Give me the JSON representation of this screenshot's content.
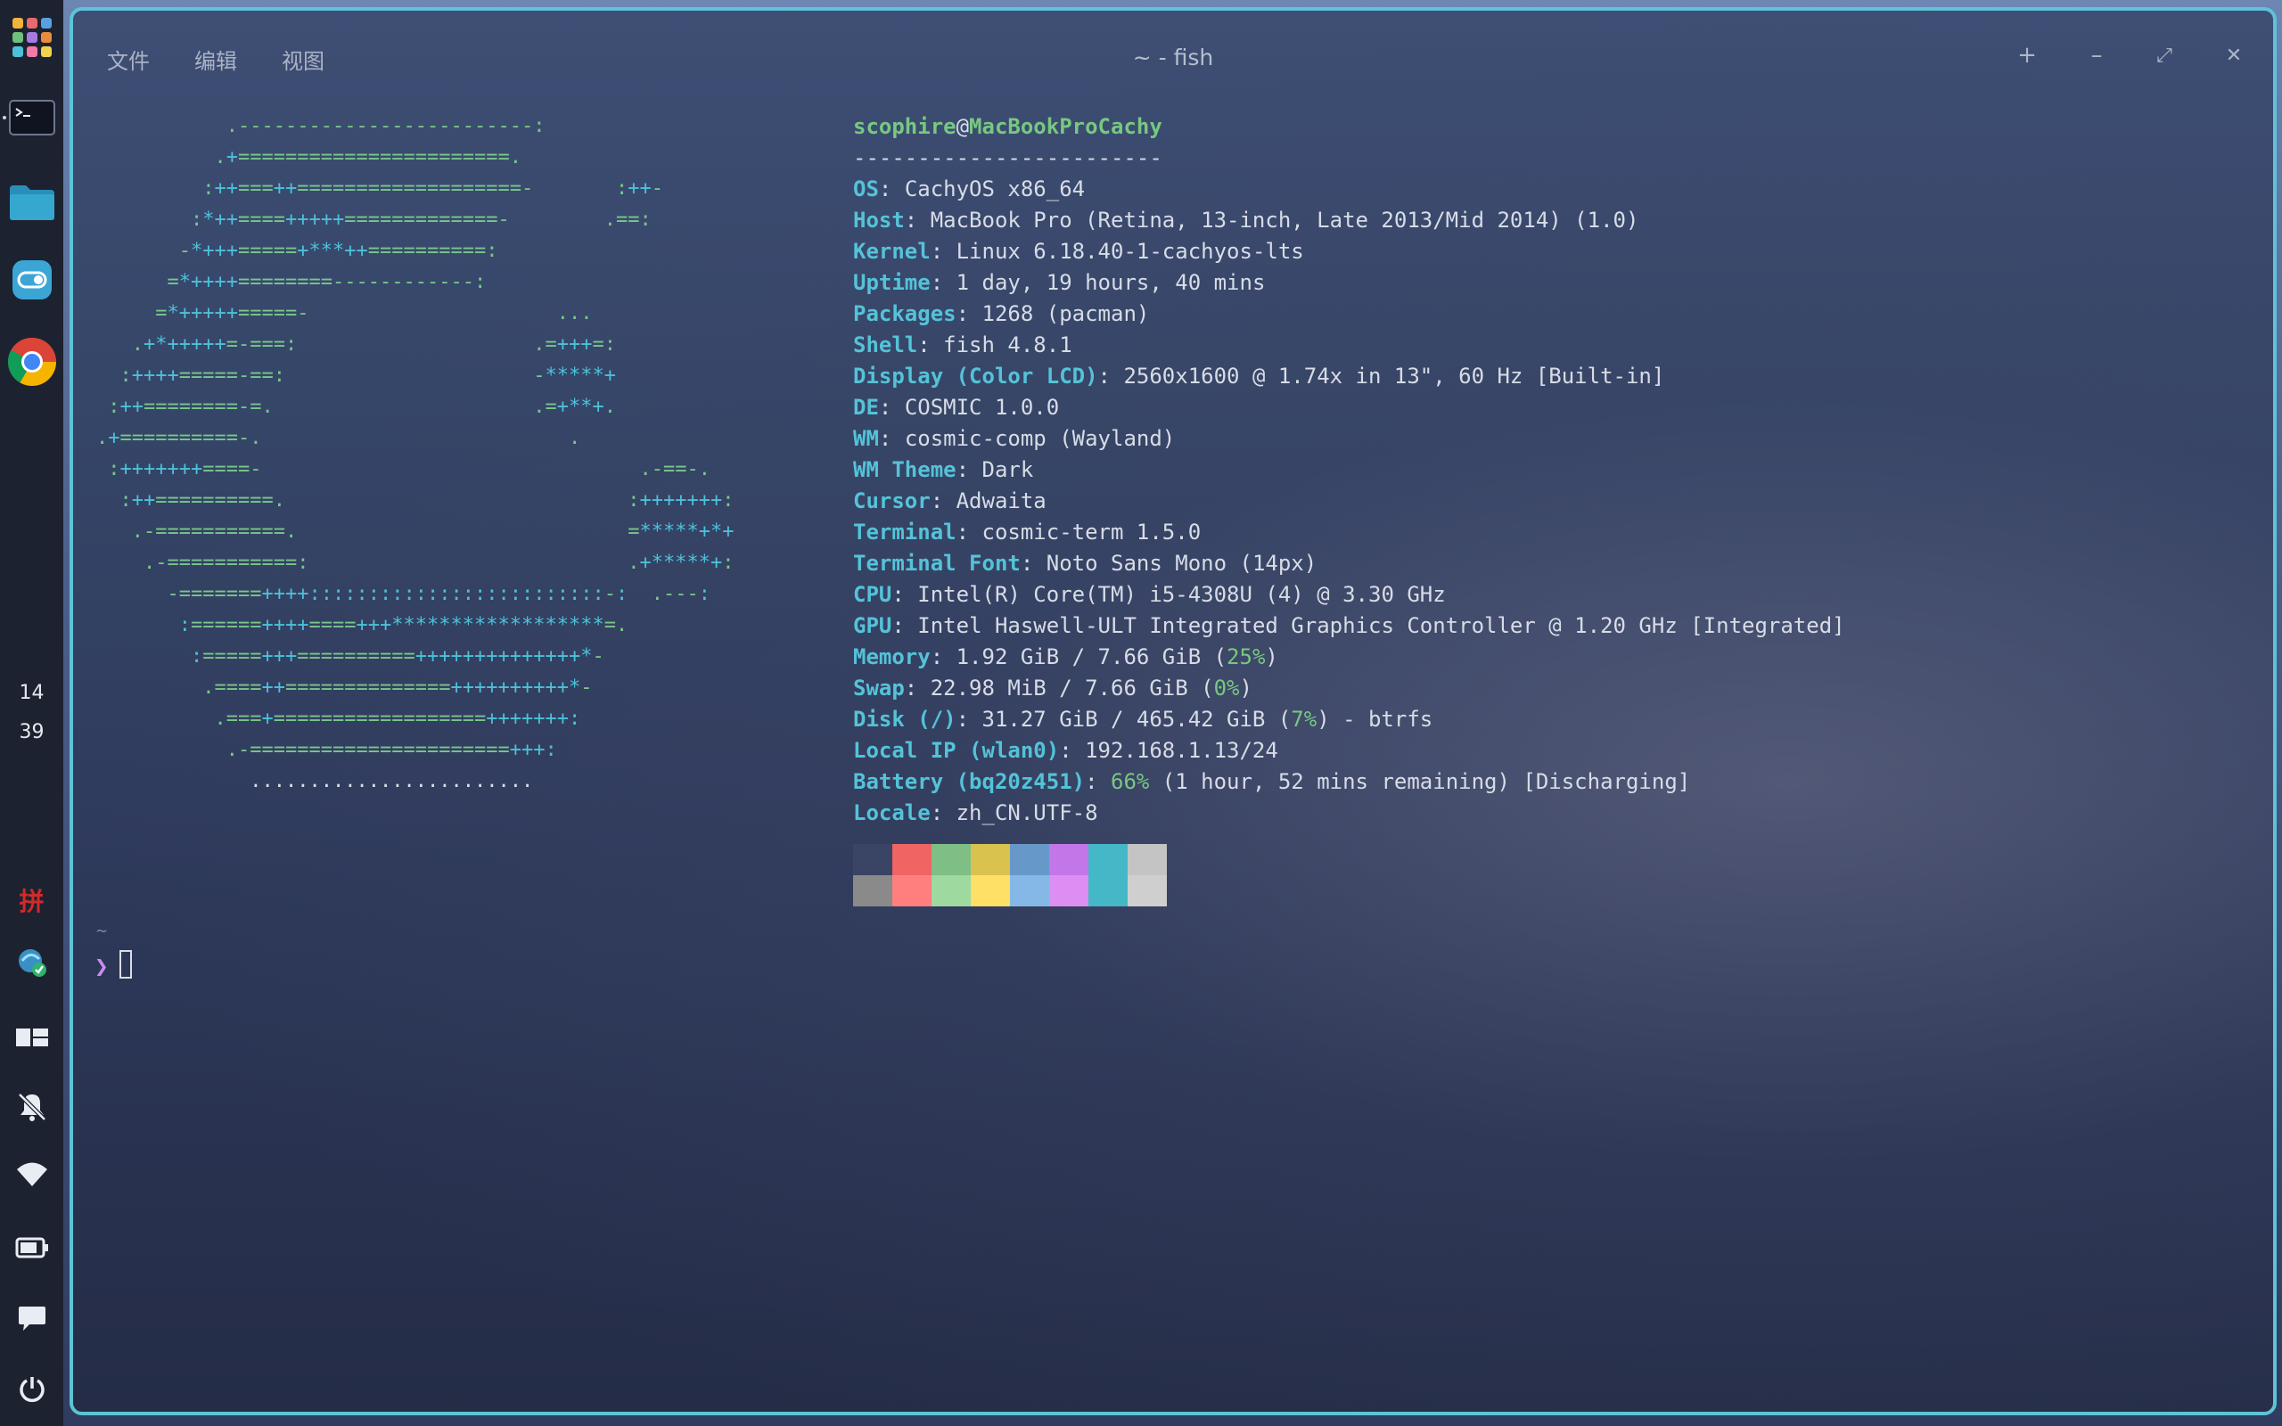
{
  "dock": {
    "clock_hour": "14",
    "clock_minute": "39",
    "ime_label": "拼",
    "items": [
      "app-launcher",
      "terminal",
      "files",
      "settings",
      "chrome",
      "ime",
      "app",
      "workspaces",
      "mute",
      "wifi",
      "battery",
      "notifications",
      "power"
    ]
  },
  "window": {
    "title": "~ - fish",
    "menu": {
      "file": "文件",
      "edit": "编辑",
      "view": "视图"
    },
    "controls": {
      "new_tab": "+",
      "minimize": "–",
      "maximize": "⤢",
      "close": "✕"
    },
    "accent": "#5ec3d6"
  },
  "logo_lines": [
    "           .-------------------------:",
    "          .+=======================.",
    "         :++===++===================-       :++-",
    "        :*++====+++++=============-        .==:",
    "       -*+++=====+***++==========:",
    "      =*++++========------------:",
    "     =*+++++=====-                     ...",
    "   .+*+++++=-===:                    .=+++=:",
    "  :++++=====-==:                     -*****+",
    " :++========-=.                      .=+**+.",
    ".+==========-.                          .",
    " :+++++++====-                                .-==-.",
    "  :++==========.                             :+++++++:",
    "   .-===========.                            =*****+*+",
    "    .-===========:                           .+*****+:",
    "      -=======++++:::::::::::::::::::::::::-:  .---:",
    "       :======++++====+++******************=.",
    "        :=====+++==========++++++++++++++*-",
    "         .====++==============++++++++++*-",
    "          .===+==================+++++++:",
    "           .-======================+++:",
    "             ........................"
  ],
  "info": {
    "user": "scophire",
    "at": "@",
    "host": "MacBookProCachy",
    "separator": "------------------------",
    "rows": [
      {
        "key": "OS",
        "value": "CachyOS x86_64"
      },
      {
        "key": "Host",
        "value": "MacBook Pro (Retina, 13-inch, Late 2013/Mid 2014) (1.0)"
      },
      {
        "key": "Kernel",
        "value": "Linux 6.18.40-1-cachyos-lts"
      },
      {
        "key": "Uptime",
        "value": "1 day, 19 hours, 40 mins"
      },
      {
        "key": "Packages",
        "value": "1268 (pacman)"
      },
      {
        "key": "Shell",
        "value": "fish 4.8.1"
      },
      {
        "key": "Display (Color LCD)",
        "value": "2560x1600 @ 1.74x in 13\", 60 Hz [Built-in]"
      },
      {
        "key": "DE",
        "value": "COSMIC 1.0.0"
      },
      {
        "key": "WM",
        "value": "cosmic-comp (Wayland)"
      },
      {
        "key": "WM Theme",
        "value": "Dark"
      },
      {
        "key": "Cursor",
        "value": "Adwaita"
      },
      {
        "key": "Terminal",
        "value": "cosmic-term 1.5.0"
      },
      {
        "key": "Terminal Font",
        "value": "Noto Sans Mono (14px)"
      },
      {
        "key": "CPU",
        "value": "Intel(R) Core(TM) i5-4308U (4) @ 3.30 GHz"
      },
      {
        "key": "GPU",
        "value": "Intel Haswell-ULT Integrated Graphics Controller @ 1.20 GHz [Integrated]"
      }
    ],
    "memory": {
      "key": "Memory",
      "pre": "1.92 GiB / 7.66 GiB (",
      "pct": "25%",
      "post": ")"
    },
    "swap": {
      "key": "Swap",
      "pre": "22.98 MiB / 7.66 GiB (",
      "pct": "0%",
      "post": ")"
    },
    "disk": {
      "key": "Disk (/)",
      "pre": "31.27 GiB / 465.42 GiB (",
      "pct": "7%",
      "post": ") - btrfs"
    },
    "local_ip": {
      "key": "Local IP (wlan0)",
      "value": "192.168.1.13/24"
    },
    "battery": {
      "key": "Battery (bq20z451)",
      "pct": "66%",
      "post": " (1 hour, 52 mins remaining) [Discharging]"
    },
    "locale": {
      "key": "Locale",
      "value": "zh_CN.UTF-8"
    }
  },
  "palette_top": [
    "#3a4464",
    "#f06464",
    "#7fbf86",
    "#d9c24d",
    "#6699c9",
    "#c276e8",
    "#44b8c6",
    "#c4c4c4"
  ],
  "palette_bottom": [
    "#8a8a8a",
    "#ff7f7f",
    "#9ed99f",
    "#ffe066",
    "#85b8e6",
    "#dc8ef2",
    "#44b8c6",
    "#cfcfcf"
  ],
  "prompt": {
    "tilde": "~",
    "symbol": "❯"
  }
}
